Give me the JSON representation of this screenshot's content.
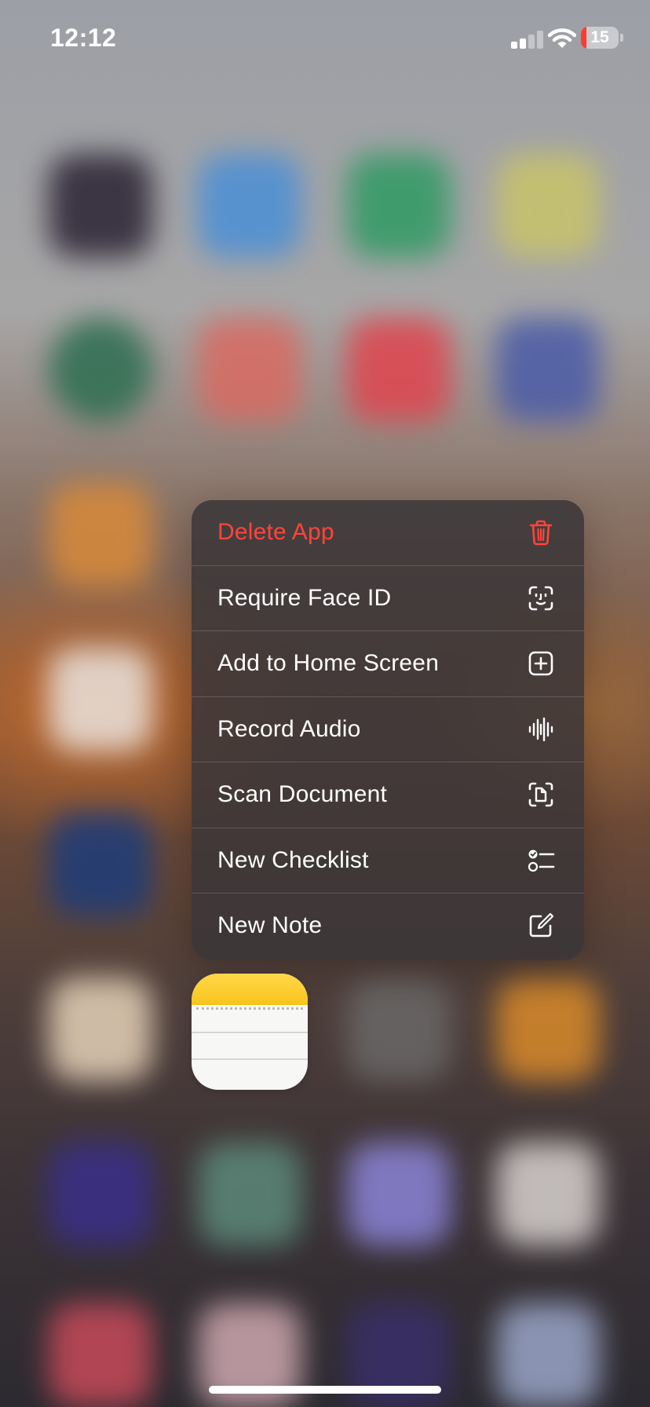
{
  "status_bar": {
    "time": "12:12",
    "battery_percent": "15",
    "battery_level": 0.15,
    "signal_bars_active": 2,
    "signal_bars_total": 4
  },
  "context_menu": {
    "items": [
      {
        "label": "Delete App",
        "icon": "trash-icon",
        "destructive": true
      },
      {
        "label": "Require Face ID",
        "icon": "face-id-icon",
        "destructive": false
      },
      {
        "label": "Add to Home Screen",
        "icon": "plus-square-icon",
        "destructive": false
      },
      {
        "label": "Record Audio",
        "icon": "waveform-icon",
        "destructive": false
      },
      {
        "label": "Scan Document",
        "icon": "doc-viewfinder-icon",
        "destructive": false
      },
      {
        "label": "New Checklist",
        "icon": "checklist-icon",
        "destructive": false
      },
      {
        "label": "New Note",
        "icon": "compose-icon",
        "destructive": false
      }
    ]
  },
  "focused_app": {
    "icon": "notes-app-icon"
  },
  "colors": {
    "destructive": "#ff453a",
    "menu_text": "#ffffff",
    "notes_yellow": "#ffd84a",
    "battery_low": "#ff3b30"
  }
}
